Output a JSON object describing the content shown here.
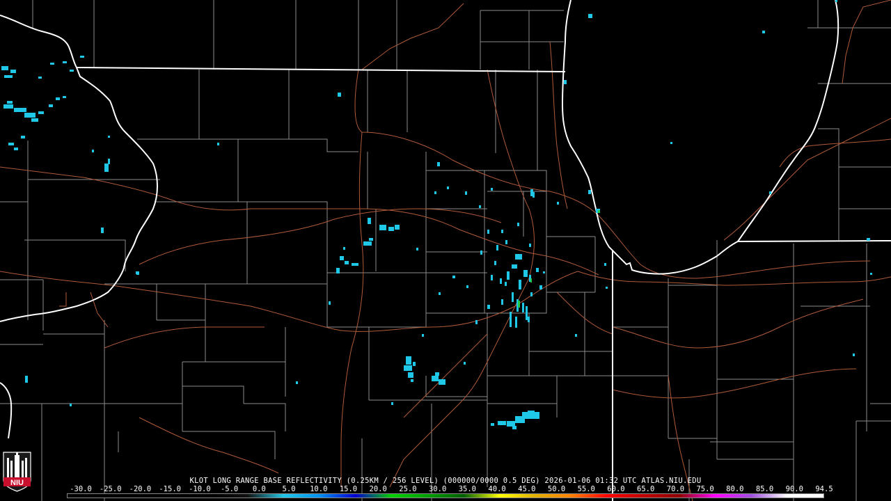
{
  "product": {
    "caption": "KLOT LONG RANGE BASE REFLECTIVITY (0.25KM / 256 LEVEL) (000000/0000 0.5 DEG) 2026-01-06 01:32 UTC  ATLAS.NIU.EDU"
  },
  "logo": {
    "text": "NIU",
    "color": "#c8102e"
  },
  "colors": {
    "background": "#000000",
    "state_border": "#ffffff",
    "county_line": "#8c8c8c",
    "highway": "#b05a3a",
    "echo": "#1ec8e6"
  },
  "scale": {
    "labels": [
      "-30.0",
      "-25.0",
      "-20.0",
      "-15.0",
      "-10.0",
      "-5.0",
      "0.0",
      "5.0",
      "10.0",
      "15.0",
      "20.0",
      "25.0",
      "30.0",
      "35.0",
      "40.0",
      "45.0",
      "50.0",
      "55.0",
      "60.0",
      "65.0",
      "70.0",
      "75.0",
      "80.0",
      "85.0",
      "90.0",
      "94.5"
    ],
    "gradient_colors": [
      "#000000",
      "#000000",
      "#000000",
      "#000000",
      "#000000",
      "#111111",
      "#22c8e8",
      "#0090f0",
      "#0000d0",
      "#00d000",
      "#00a000",
      "#006000",
      "#ffff00",
      "#e0b000",
      "#ff8000",
      "#ff0000",
      "#c00000",
      "#900000",
      "#ff00ff",
      "#a050e0",
      "#ffffff",
      "#ffffff"
    ]
  }
}
